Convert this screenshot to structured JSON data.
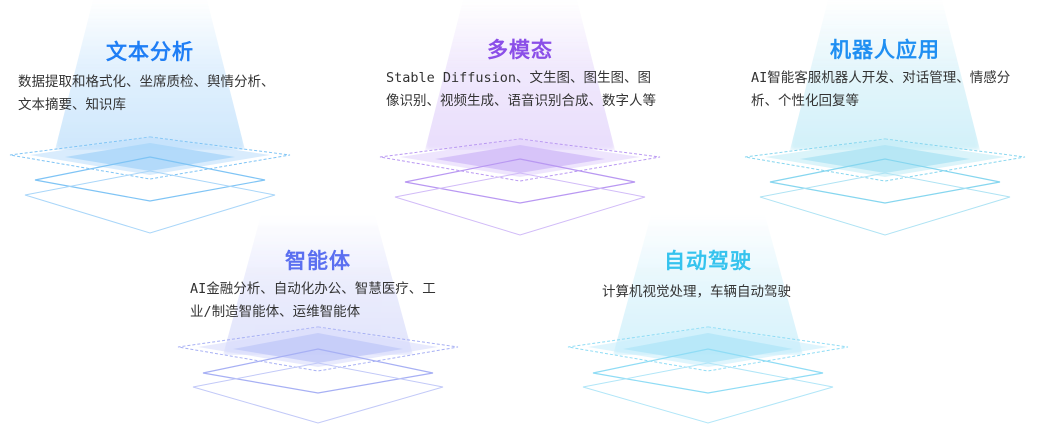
{
  "cards": [
    {
      "title": "文本分析",
      "desc": "数据提取和格式化、坐席质检、舆情分析、文本摘要、知识库",
      "color": "#1f7ef5",
      "tint": "#bfe0fb",
      "tint_dark": "#7fc4f5"
    },
    {
      "title": "多模态",
      "desc": "Stable Diffusion、文生图、图生图、图像识别、视频生成、语音识别合成、数字人等",
      "color": "#8b4fe8",
      "tint": "#e2d3fb",
      "tint_dark": "#b998f2"
    },
    {
      "title": "机器人应用",
      "desc": "AI智能客服机器人开发、对话管理、情感分析、个性化回复等",
      "color": "#1f8ff2",
      "tint": "#c3ecf7",
      "tint_dark": "#86d6ef"
    },
    {
      "title": "智能体",
      "desc": "AI金融分析、自动化办公、智慧医疗、工业/制造智能体、运维智能体",
      "color": "#5b6ff0",
      "tint": "#d8dcfb",
      "tint_dark": "#a7b0f4"
    },
    {
      "title": "自动驾驶",
      "desc": "计算机视觉处理，车辆自动驾驶",
      "color": "#35c3ee",
      "tint": "#c9eefb",
      "tint_dark": "#8fdcf5"
    }
  ]
}
